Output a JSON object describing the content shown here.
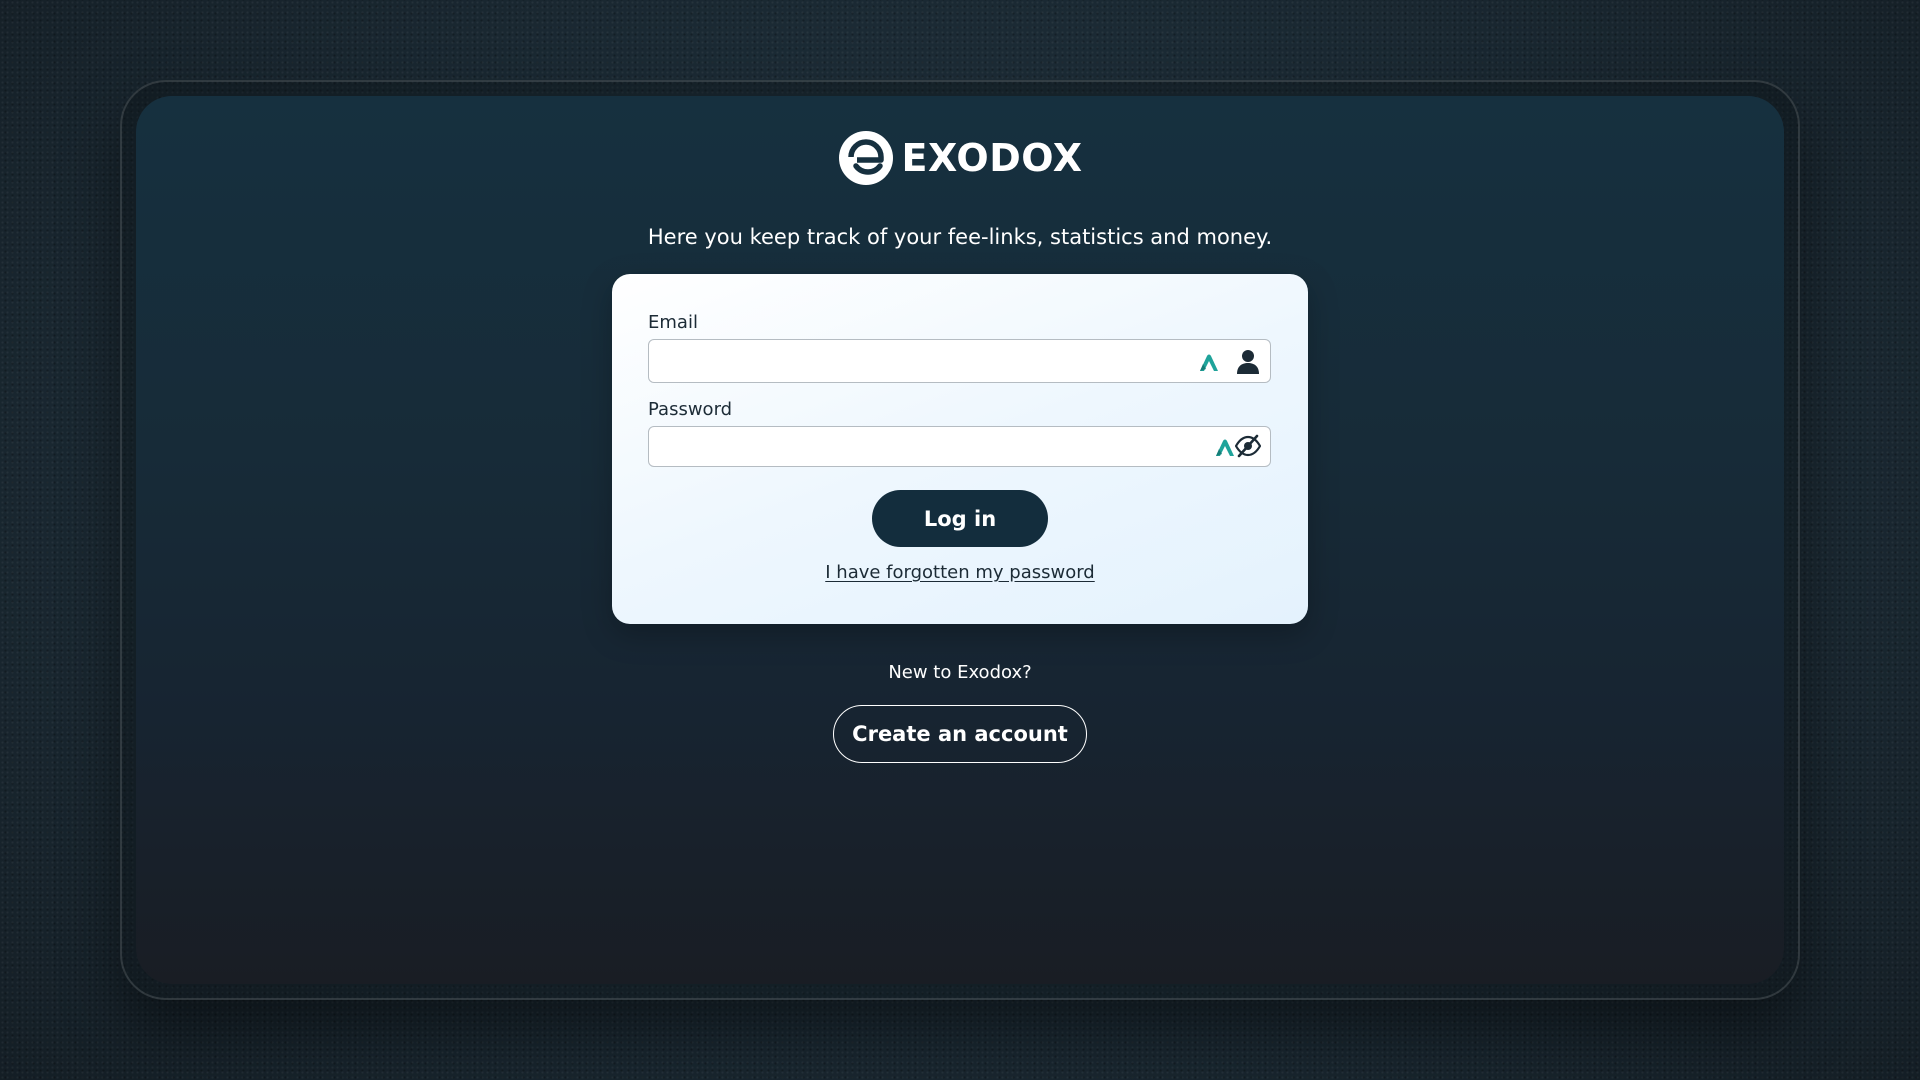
{
  "brand": {
    "name": "EXODOX",
    "tagline": "Here you keep track of your fee-links, statistics and money."
  },
  "login_form": {
    "email_label": "Email",
    "email_value": "",
    "password_label": "Password",
    "password_value": "",
    "login_button": "Log in",
    "forgot_link": "I have forgotten my password"
  },
  "signup": {
    "prompt": "New to Exodox?",
    "button": "Create an account"
  },
  "icons": {
    "logo": "exodox-logo-icon",
    "email_extension": "password-manager-icon",
    "email_trailing": "user-icon",
    "password_extension": "password-manager-icon",
    "password_trailing": "eye-slash-icon"
  },
  "colors": {
    "primary_button": "#132d3d",
    "accent_teal": "#1fa39a",
    "card_background": "#eef7fe",
    "text_light": "#ffffff",
    "text_dark": "#1c2b36"
  }
}
